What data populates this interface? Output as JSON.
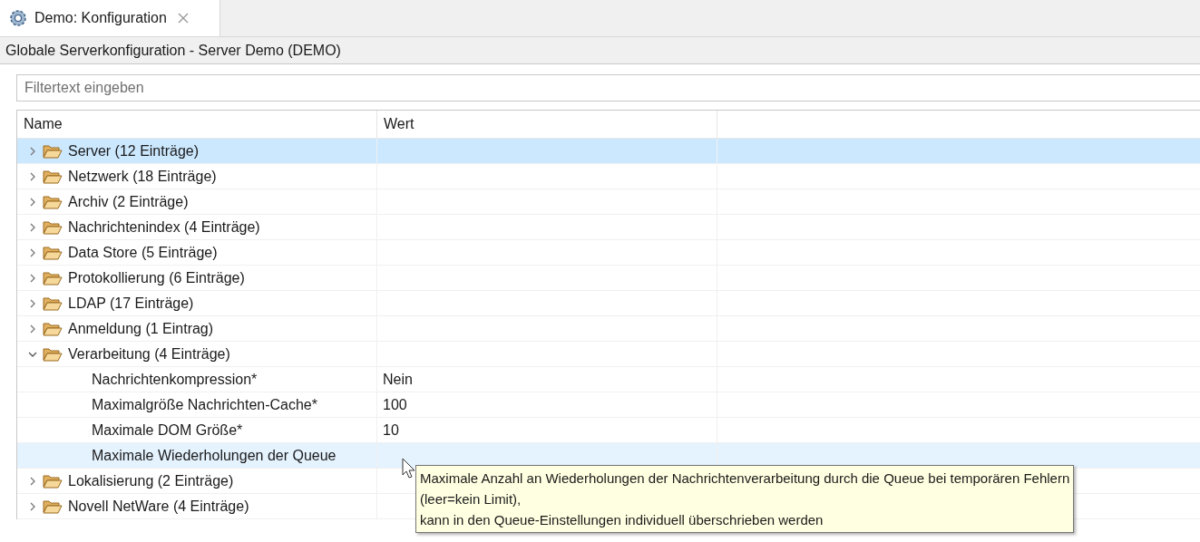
{
  "tab": {
    "title": "Demo: Konfiguration",
    "selected": true
  },
  "header": {
    "title": "Globale Serverkonfiguration - Server Demo (DEMO)"
  },
  "filter": {
    "placeholder": "Filtertext eingeben"
  },
  "table": {
    "columns": [
      "Name",
      "Wert"
    ],
    "rows": [
      {
        "name": "Server (12 Einträge)",
        "expanded": false,
        "selected": true,
        "hovered": false
      },
      {
        "name": "Netzwerk (18 Einträge)",
        "expanded": false,
        "selected": false,
        "hovered": false
      },
      {
        "name": "Archiv (2 Einträge)",
        "expanded": false,
        "selected": false,
        "hovered": false
      },
      {
        "name": "Nachrichtenindex (4 Einträge)",
        "expanded": false,
        "selected": false,
        "hovered": false
      },
      {
        "name": "Data Store (5 Einträge)",
        "expanded": false,
        "selected": false,
        "hovered": false
      },
      {
        "name": "Protokollierung (6 Einträge)",
        "expanded": false,
        "selected": false,
        "hovered": false
      },
      {
        "name": "LDAP (17 Einträge)",
        "expanded": false,
        "selected": false,
        "hovered": false
      },
      {
        "name": "Anmeldung (1 Eintrag)",
        "expanded": false,
        "selected": false,
        "hovered": false
      },
      {
        "name": "Verarbeitung (4 Einträge)",
        "expanded": true,
        "selected": false,
        "hovered": false,
        "children": [
          {
            "name": "Nachrichtenkompression*",
            "value": "Nein",
            "selected": false,
            "hovered": false
          },
          {
            "name": "Maximalgröße Nachrichten-Cache*",
            "value": "100",
            "selected": false,
            "hovered": false
          },
          {
            "name": "Maximale DOM Größe*",
            "value": "10",
            "selected": false,
            "hovered": false
          },
          {
            "name": "Maximale Wiederholungen der Queue",
            "selected": false,
            "hovered": true
          }
        ]
      },
      {
        "name": "Lokalisierung (2 Einträge)",
        "expanded": false,
        "selected": false,
        "hovered": false
      },
      {
        "name": "Novell NetWare (4 Einträge)",
        "expanded": false,
        "selected": false,
        "hovered": false
      }
    ]
  },
  "tooltip": {
    "lines": [
      "Maximale Anzahl an Wiederholungen der Nachrichtenverarbeitung durch die Queue bei temporären Fehlern",
      "(leer=kein Limit),",
      "kann in den Queue-Einstellungen individuell überschrieben werden"
    ]
  }
}
